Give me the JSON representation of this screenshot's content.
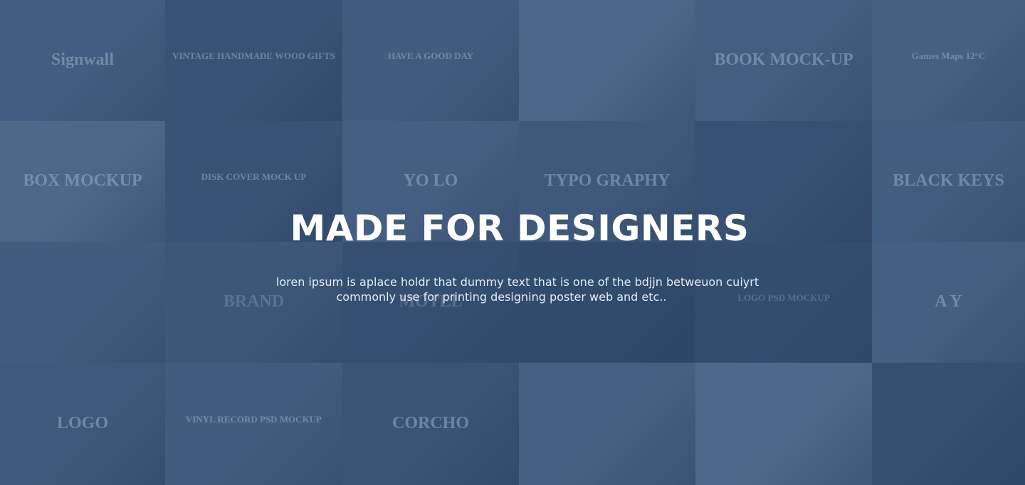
{
  "hero": {
    "title": "MADE FOR DESIGNERS",
    "subtitle_line1": "loren ipsum is aplace holdr that dummy text that is  one of the bdjjn betweuon cuiyrt",
    "subtitle_line2": "commonly use for printing designing poster web and etc.."
  },
  "mockups": [
    {
      "name": "signwall-mockup",
      "color": "#4b6689",
      "label": "Signwall"
    },
    {
      "name": "vintage-handmade-mockup",
      "color": "#3c5779",
      "label": "VINTAGE HANDMADE WOOD GIFTS"
    },
    {
      "name": "tablet-mockup",
      "color": "#4a6588",
      "label": "HAVE A GOOD DAY"
    },
    {
      "name": "stationery-mockup",
      "color": "#5a7495",
      "label": ""
    },
    {
      "name": "book-mockup",
      "color": "#4d6789",
      "label": "BOOK MOCK-UP"
    },
    {
      "name": "phone-app-mockup",
      "color": "#506a8b",
      "label": "Games  Maps  12°C"
    },
    {
      "name": "box-mockup",
      "color": "#5b7596",
      "label": "BOX MOCKUP"
    },
    {
      "name": "disk-cover-mockup",
      "color": "#3d5779",
      "label": "DISK COVER MOCK UP"
    },
    {
      "name": "bag-tag-mockup",
      "color": "#4f698b",
      "label": "YO LO"
    },
    {
      "name": "typography-mockup",
      "color": "#45607f",
      "label": "TYPO GRAPHY"
    },
    {
      "name": "waterfall-photo",
      "color": "#3a5273",
      "label": ""
    },
    {
      "name": "black-keys-book-mockup",
      "color": "#4c6688",
      "label": "BLACK KEYS"
    },
    {
      "name": "branding-mockup",
      "color": "#4a6587",
      "label": ""
    },
    {
      "name": "brand-device-mockup",
      "color": "#526c8d",
      "label": "BRAND"
    },
    {
      "name": "motel-sign-mockup",
      "color": "#3f5a7c",
      "label": "MOTEL"
    },
    {
      "name": "clipboard-mockup",
      "color": "#36506f",
      "label": ""
    },
    {
      "name": "embroidered-logo-mockup",
      "color": "#3b5576",
      "label": "LOGO PSD MOCKUP"
    },
    {
      "name": "badge-logo-mockup",
      "color": "#4f698a",
      "label": "A Y"
    },
    {
      "name": "business-cards-mockup",
      "color": "#465f80",
      "label": "LOGO"
    },
    {
      "name": "vinyl-record-mockup",
      "color": "#4b6587",
      "label": "VINYL RECORD PSD MOCKUP"
    },
    {
      "name": "corcho-cards-mockup",
      "color": "#3e5879",
      "label": "CORCHO"
    },
    {
      "name": "monitor-mockup",
      "color": "#516b8c",
      "label": ""
    },
    {
      "name": "letterhead-mockup",
      "color": "#5d7798",
      "label": ""
    },
    {
      "name": "portrait-photo",
      "color": "#36506f",
      "label": ""
    }
  ]
}
